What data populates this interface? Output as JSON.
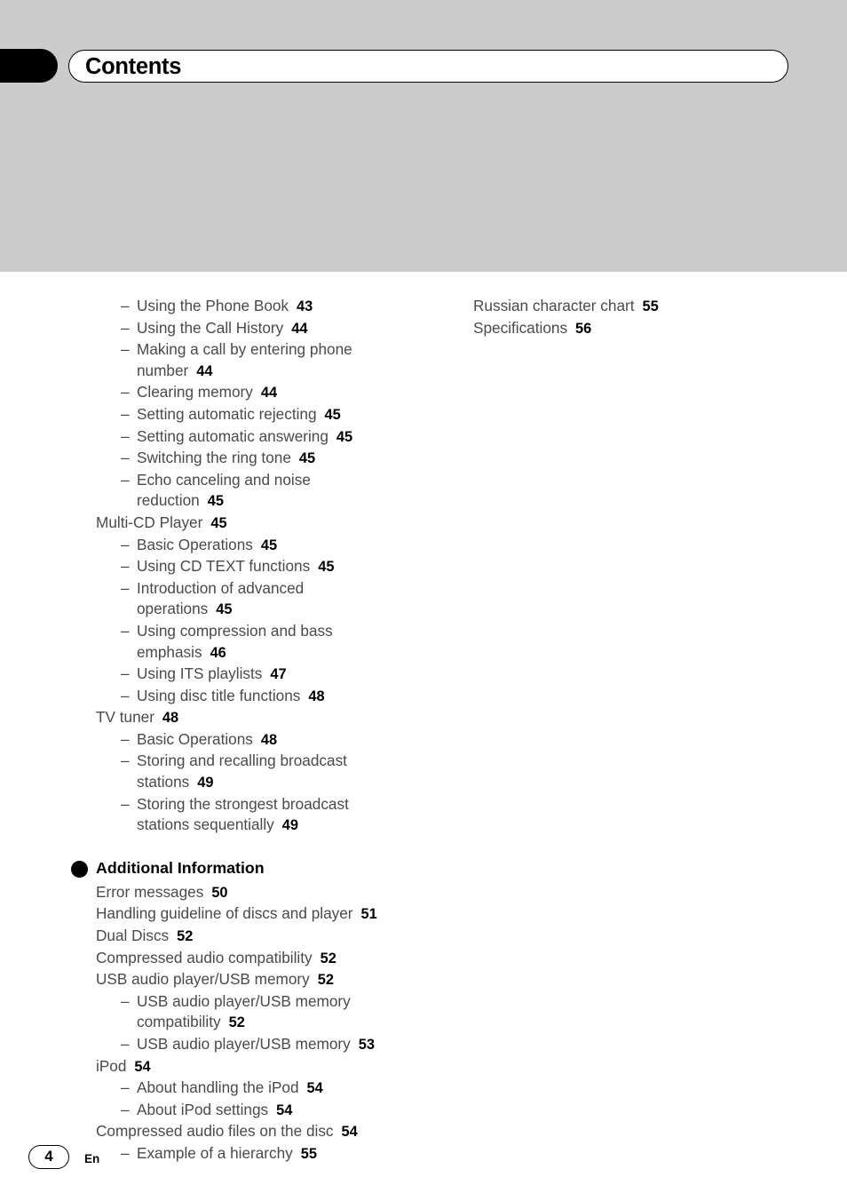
{
  "header": {
    "title": "Contents",
    "tab_icon": "black-tab-marker"
  },
  "footer": {
    "page_number": "4",
    "language_code": "En"
  },
  "toc": {
    "left_column": [
      {
        "level": 2,
        "text": "Using the Phone Book",
        "page": "43"
      },
      {
        "level": 2,
        "text": "Using the Call History",
        "page": "44"
      },
      {
        "level": 2,
        "text": "Making a call by entering phone",
        "text2": "number",
        "page": "44"
      },
      {
        "level": 2,
        "text": "Clearing memory",
        "page": "44"
      },
      {
        "level": 2,
        "text": "Setting automatic rejecting",
        "page": "45"
      },
      {
        "level": 2,
        "text": "Setting automatic answering",
        "page": "45"
      },
      {
        "level": 2,
        "text": "Switching the ring tone",
        "page": "45"
      },
      {
        "level": 2,
        "text": "Echo canceling and noise",
        "text2": "reduction",
        "page": "45"
      },
      {
        "level": 1,
        "text": "Multi-CD Player",
        "page": "45"
      },
      {
        "level": 2,
        "text": "Basic Operations",
        "page": "45"
      },
      {
        "level": 2,
        "text": "Using CD TEXT functions",
        "page": "45"
      },
      {
        "level": 2,
        "text": "Introduction of advanced",
        "text2": "operations",
        "page": "45"
      },
      {
        "level": 2,
        "text": "Using compression and bass",
        "text2": "emphasis",
        "page": "46"
      },
      {
        "level": 2,
        "text": "Using ITS playlists",
        "page": "47"
      },
      {
        "level": 2,
        "text": "Using disc title functions",
        "page": "48"
      },
      {
        "level": 1,
        "text": "TV tuner",
        "page": "48"
      },
      {
        "level": 2,
        "text": "Basic Operations",
        "page": "48"
      },
      {
        "level": 2,
        "text": "Storing and recalling broadcast",
        "text2": "stations",
        "page": "49"
      },
      {
        "level": 2,
        "text": "Storing the strongest broadcast",
        "text2": "stations sequentially",
        "page": "49"
      }
    ],
    "section": {
      "title": "Additional Information",
      "items": [
        {
          "level": 1,
          "text": "Error messages",
          "page": "50"
        },
        {
          "level": 1,
          "text": "Handling guideline of discs and player",
          "page": "51"
        },
        {
          "level": 1,
          "text": "Dual Discs",
          "page": "52"
        },
        {
          "level": 1,
          "text": "Compressed audio compatibility",
          "page": "52"
        },
        {
          "level": 1,
          "text": "USB audio player/USB memory",
          "page": "52"
        },
        {
          "level": 2,
          "text": "USB audio player/USB memory",
          "text2": "compatibility",
          "page": "52"
        },
        {
          "level": 2,
          "text": "USB audio player/USB memory",
          "page": "53"
        },
        {
          "level": 1,
          "text": "iPod",
          "page": "54"
        },
        {
          "level": 2,
          "text": "About handling the iPod",
          "page": "54"
        },
        {
          "level": 2,
          "text": "About iPod settings",
          "page": "54"
        },
        {
          "level": 1,
          "text": "Compressed audio files on the disc",
          "page": "54"
        },
        {
          "level": 2,
          "text": "Example of a hierarchy",
          "page": "55"
        }
      ]
    },
    "right_column": [
      {
        "level": 1,
        "text": "Russian character chart",
        "page": "55"
      },
      {
        "level": 1,
        "text": "Specifications",
        "page": "56"
      }
    ]
  }
}
